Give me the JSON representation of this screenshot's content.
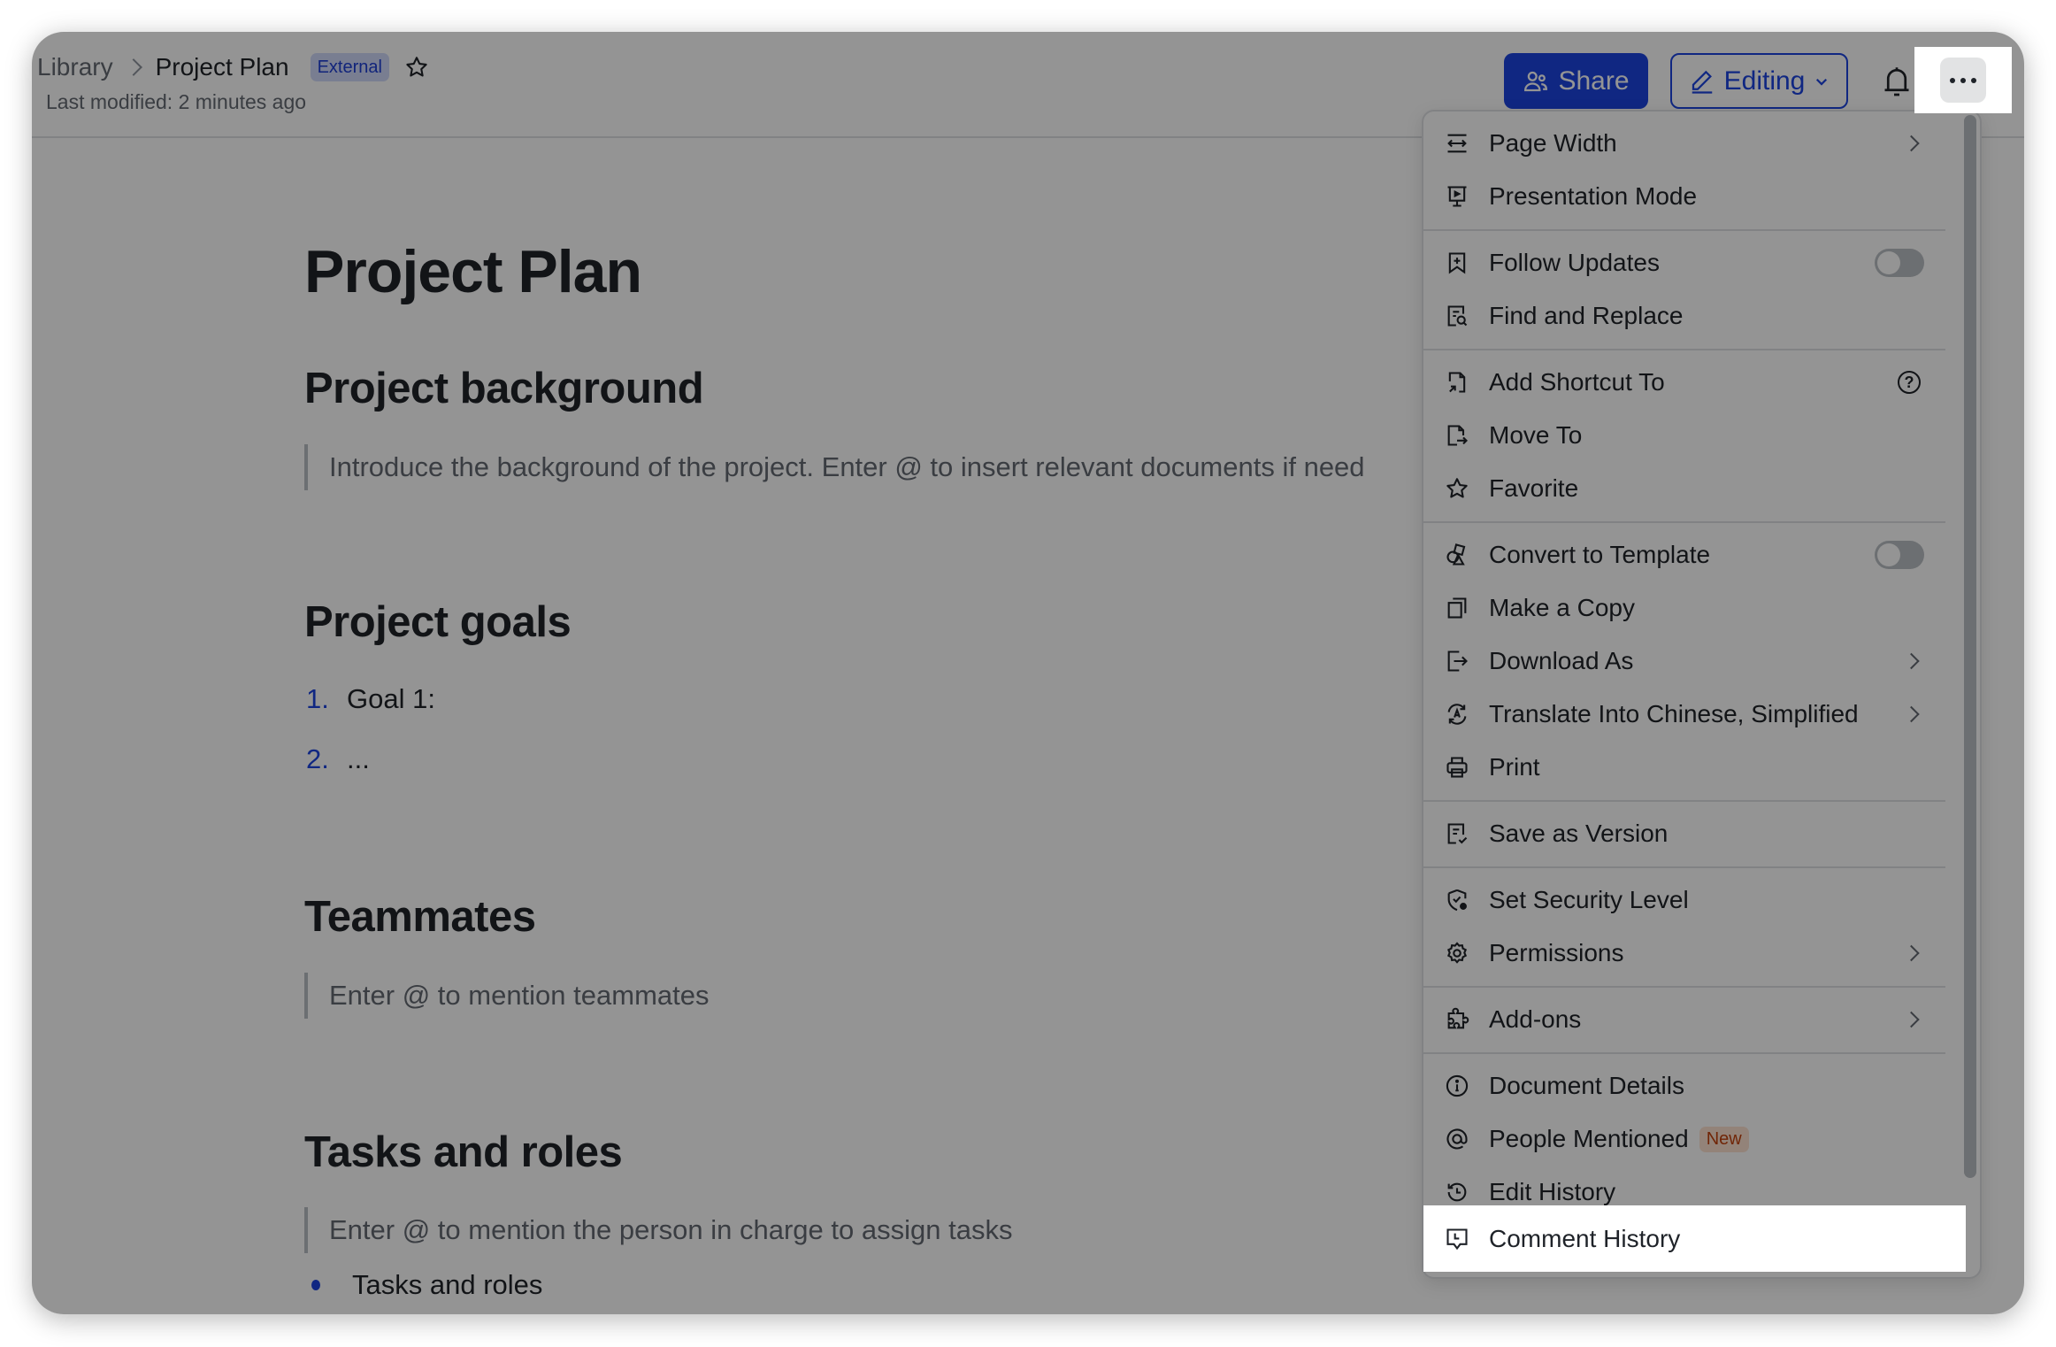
{
  "header": {
    "breadcrumb": [
      "Library",
      "Project Plan"
    ],
    "badge": "External",
    "last_modified": "Last modified: 2 minutes ago",
    "share_label": "Share",
    "editing_label": "Editing",
    "icons": [
      "star-icon",
      "people-icon",
      "pencil-icon",
      "chevron-down-icon",
      "bell-icon",
      "more-icon"
    ]
  },
  "document": {
    "title": "Project Plan",
    "sections": [
      {
        "heading": "Project background",
        "placeholder": "Introduce the background of the project. Enter @ to insert relevant documents if need"
      },
      {
        "heading": "Project goals",
        "list": [
          {
            "num": "1.",
            "text": "Goal 1:"
          },
          {
            "num": "2.",
            "text": "..."
          }
        ]
      },
      {
        "heading": "Teammates",
        "placeholder": "Enter @ to mention teammates"
      },
      {
        "heading": "Tasks and roles",
        "placeholder": "Enter @ to mention the person in charge to assign tasks",
        "bullets": [
          "Tasks and roles"
        ]
      }
    ]
  },
  "menu": {
    "items": [
      {
        "label": "Page Width",
        "icon": "page-width-icon",
        "right": "chevron"
      },
      {
        "label": "Presentation Mode",
        "icon": "presentation-icon"
      },
      {
        "label": "Follow Updates",
        "icon": "bookmark-plus-icon",
        "right": "toggle",
        "toggle_on": false
      },
      {
        "label": "Find and Replace",
        "icon": "find-replace-icon"
      },
      {
        "label": "Add Shortcut To",
        "icon": "shortcut-icon",
        "right": "help"
      },
      {
        "label": "Move To",
        "icon": "move-icon"
      },
      {
        "label": "Favorite",
        "icon": "star-icon"
      },
      {
        "label": "Convert to Template",
        "icon": "template-icon",
        "right": "toggle",
        "toggle_on": false
      },
      {
        "label": "Make a Copy",
        "icon": "copy-icon"
      },
      {
        "label": "Download As",
        "icon": "download-icon",
        "right": "chevron"
      },
      {
        "label": "Translate Into Chinese, Simplified",
        "icon": "translate-icon",
        "right": "chevron"
      },
      {
        "label": "Print",
        "icon": "printer-icon"
      },
      {
        "label": "Save as Version",
        "icon": "save-version-icon"
      },
      {
        "label": "Set Security Level",
        "icon": "shield-icon"
      },
      {
        "label": "Permissions",
        "icon": "gear-icon",
        "right": "chevron"
      },
      {
        "label": "Add-ons",
        "icon": "addons-icon",
        "right": "chevron"
      },
      {
        "label": "Document Details",
        "icon": "info-icon"
      },
      {
        "label": "People Mentioned",
        "icon": "at-icon",
        "badge": "New"
      },
      {
        "label": "Edit History",
        "icon": "history-icon"
      },
      {
        "label": "Comment History",
        "icon": "comment-history-icon",
        "highlighted": true
      }
    ],
    "help_glyph": "?"
  },
  "colors": {
    "accent": "#1c44e0",
    "overlay": "rgba(0,0,0,0.42)",
    "badge_new_text": "#c2410c",
    "badge_external_bg": "#d1d9fa"
  }
}
